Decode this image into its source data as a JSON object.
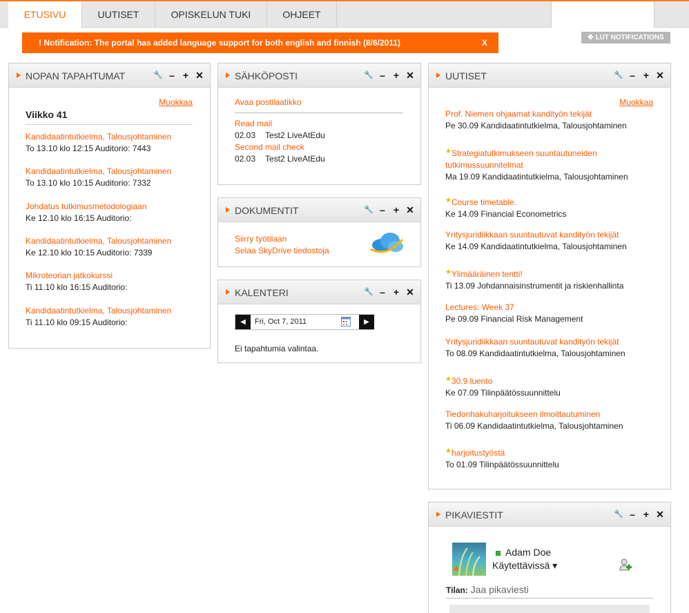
{
  "tabs": [
    {
      "label": "ETUSIVU",
      "active": true
    },
    {
      "label": "UUTISET",
      "active": false
    },
    {
      "label": "OPISKELUN TUKI",
      "active": false
    },
    {
      "label": "OHJEET",
      "active": false
    }
  ],
  "notification": {
    "text": "! Notification: The portal has added language support for both english and finnish (8/6/2011)",
    "close": "X"
  },
  "lut_button": "✥ LUT NOTIFICATIONS",
  "panel_tools": {
    "config": "🔧",
    "minimize": "–",
    "expand": "+",
    "close": "✕"
  },
  "nopan": {
    "title": "NOPAN TAPAHTUMAT",
    "edit": "Muokkaa",
    "week": "Viikko 41",
    "events": [
      {
        "title": "Kandidaatintutkielma, Talousjohtaminen",
        "info": "To 13.10 klo 12:15 Auditorio: 7443"
      },
      {
        "title": "Kandidaatintutkielma, Talousjohtaminen",
        "info": "To 13.10 klo 10:15 Auditorio: 7332"
      },
      {
        "title": "Johdatus tutkimusmetodologiaan",
        "info": "Ke 12.10 klo 16:15 Auditorio:"
      },
      {
        "title": "Kandidaatintutkielma, Talousjohtaminen",
        "info": "Ke 12.10 klo 10:15 Auditorio: 7339"
      },
      {
        "title": "Mikroteorian jatkokurssi",
        "info": "Ti 11.10 klo 16:15 Auditorio:"
      },
      {
        "title": "Kandidaatintutkielma, Talousjohtaminen",
        "info": "Ti 11.10 klo 09:15 Auditorio:"
      }
    ]
  },
  "sahkoposti": {
    "title": "SÄHKÖPOSTI",
    "open": "Avaa postilaatikko",
    "mails": [
      {
        "subject": "Read mail",
        "date": "02.03",
        "sender": "Test2 LiveAtEdu"
      },
      {
        "subject": "Second mail check",
        "date": "02.03",
        "sender": "Test2 LiveAtEdu"
      }
    ]
  },
  "dokumentit": {
    "title": "DOKUMENTIT",
    "links": [
      "Siirry työtilaan",
      "Selaa SkyDrive tiedostoja"
    ]
  },
  "kalenteri": {
    "title": "KALENTERI",
    "prev": "◀",
    "next": "▶",
    "date": "Fri, Oct 7, 2011",
    "empty": "Ei tapahtumia valintaa."
  },
  "uutiset": {
    "title": "UUTISET",
    "edit": "Muokkaa",
    "items": [
      {
        "title": "Prof. Niemen ohjaamat kandityön tekijät",
        "info": "Pe 30.09 Kandidaatintutkielma, Talousjohtaminen",
        "star": false
      },
      {
        "title": "Strategiatutkimukseen suuntautuneiden tutkimussuunnitelmat",
        "info": "Ma 19.09 Kandidaatintutkielma, Talousjohtaminen",
        "star": true
      },
      {
        "title": "Course timetable.",
        "info": "Ke 14.09 Financial Econometrics",
        "star": true
      },
      {
        "title": "Yritysjuridiikkaan suuntautuvat kandityön tekijät",
        "info": "Ke 14.09 Kandidaatintutkielma, Talousjohtaminen",
        "star": false
      },
      {
        "title": "Ylimääräinen tentti!",
        "info": "Ti 13.09 Johdannaisinstrumentit ja riskienhallinta",
        "star": true
      },
      {
        "title": "Lectures: Week 37",
        "info": "Pe 09.09 Financial Risk Management",
        "star": false
      },
      {
        "title": "Yritysjuridiikkaan suuntautuvat kandityön tekijät",
        "info": "To 08.09 Kandidaatintutkielma, Talousjohtaminen",
        "star": false
      },
      {
        "title": "30.9 luento",
        "info": "Ke 07.09 Tilinpäätössuunnittelu",
        "star": true
      },
      {
        "title": "Tiedonhakuharjoitukseen ilmoittautuminen",
        "info": "Ti 06.09 Kandidaatintutkielma, Talousjohtaminen",
        "star": false
      },
      {
        "title": "harjoitustyöstä",
        "info": "To 01.09 Tilinpäätössuunnittelu",
        "star": true
      }
    ]
  },
  "pikaviestit": {
    "title": "PIKAVIESTIT",
    "name": "Adam Doe",
    "status": "Käytettävissä ▾",
    "tila_label": "Tilan:",
    "tila_value": "Jaa pikaviesti"
  }
}
